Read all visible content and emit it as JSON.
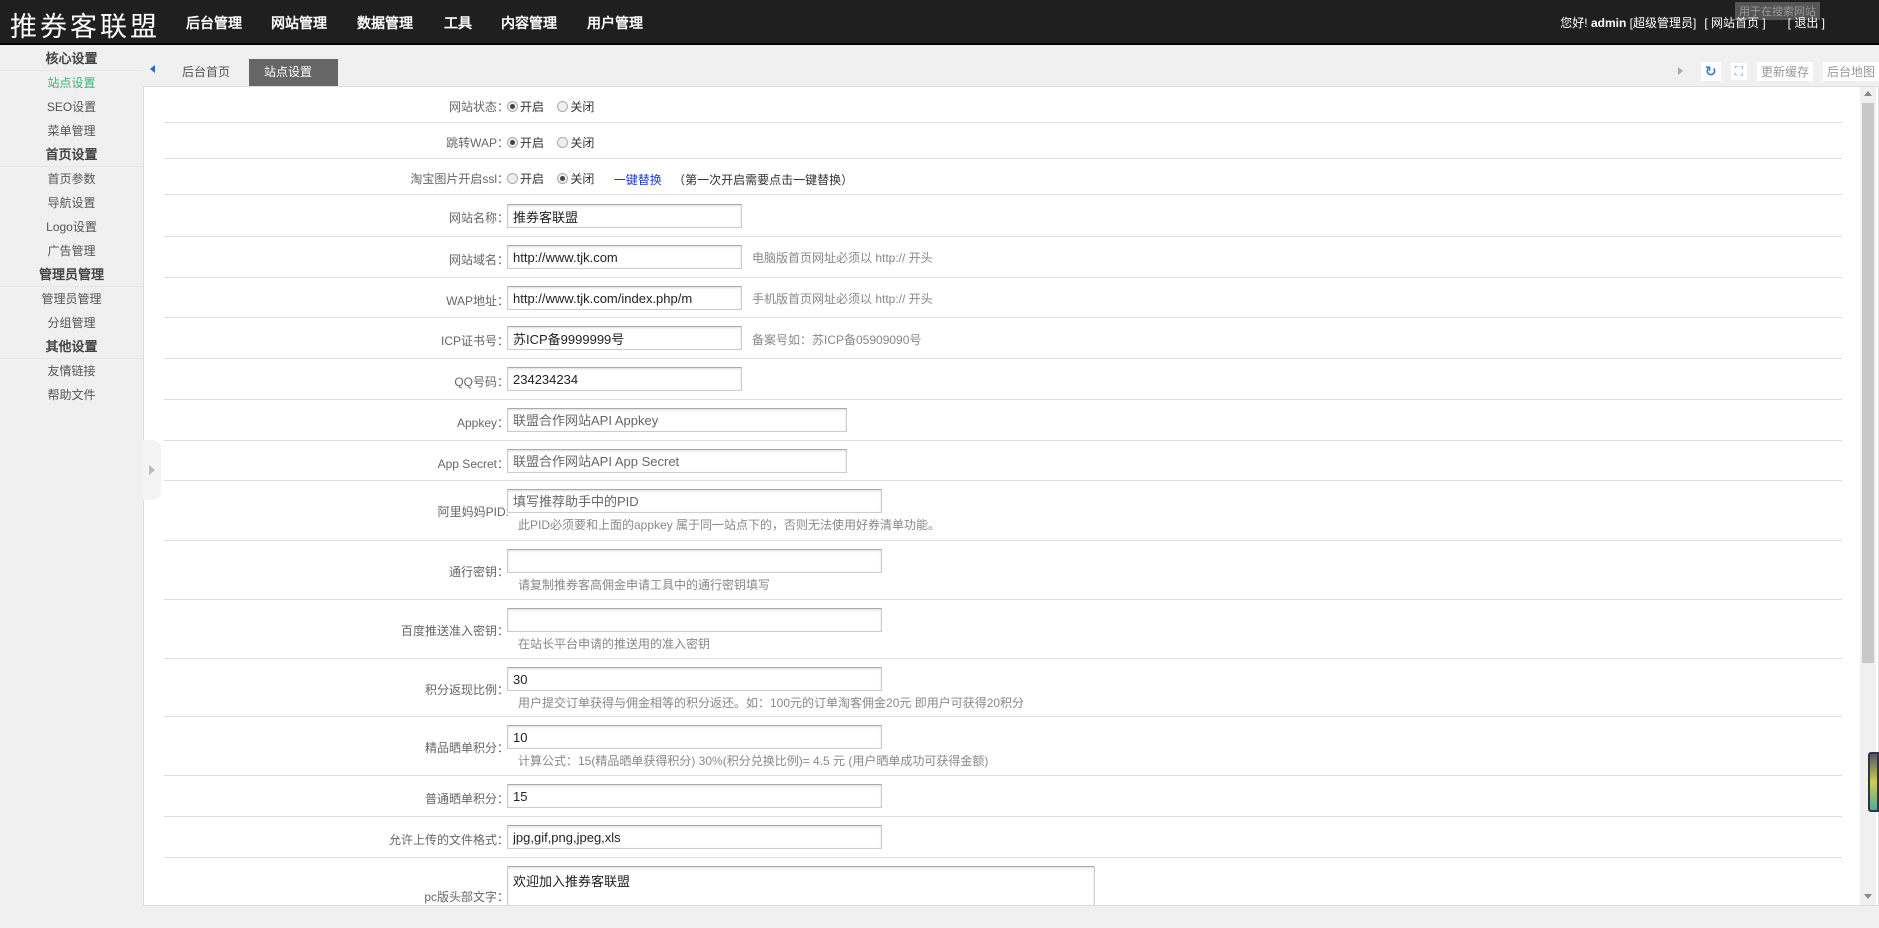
{
  "header": {
    "logo": "推券客联盟",
    "nav": [
      "后台管理",
      "网站管理",
      "数据管理",
      "工具",
      "内容管理",
      "用户管理"
    ],
    "greeting": "您好!",
    "user": "admin",
    "role": "[超级管理员]",
    "home_link": "[ 网站首页 ]",
    "logout": "[ 退出 ]",
    "tooltip": "用于在搜索网站"
  },
  "sidebar": [
    {
      "group": "核心设置",
      "items": [
        "站点设置",
        "SEO设置",
        "菜单管理"
      ]
    },
    {
      "group": "首页设置",
      "items": [
        "首页参数",
        "导航设置",
        "Logo设置",
        "广告管理"
      ]
    },
    {
      "group": "管理员管理",
      "items": [
        "管理员管理",
        "分组管理"
      ]
    },
    {
      "group": "其他设置",
      "items": [
        "友情链接",
        "帮助文件"
      ]
    }
  ],
  "tabs": {
    "home": "后台首页",
    "active": "站点设置",
    "close": "×",
    "refresh_cache": "更新缓存",
    "sitemap": "后台地图"
  },
  "form": {
    "site_status": {
      "label": "网站状态：",
      "on": "开启",
      "off": "关闭",
      "value": "on"
    },
    "wap_redirect": {
      "label": "跳转WAP：",
      "on": "开启",
      "off": "关闭",
      "value": "on"
    },
    "taobao_ssl": {
      "label": "淘宝图片开启ssl：",
      "on": "开启",
      "off": "关闭",
      "value": "off",
      "link": "一键替换",
      "note": "（第一次开启需要点击一键替换）"
    },
    "site_name": {
      "label": "网站名称：",
      "value": "推券客联盟"
    },
    "domain": {
      "label": "网站域名：",
      "value": "http://www.tjk.com",
      "hint": "电脑版首页网址必须以 http:// 开头"
    },
    "wap_url": {
      "label": "WAP地址：",
      "value": "http://www.tjk.com/index.php/m",
      "hint": "手机版首页网址必须以 http:// 开头"
    },
    "icp": {
      "label": "ICP证书号：",
      "value": "苏ICP备9999999号",
      "hint": "备案号如：苏ICP备05909090号"
    },
    "qq": {
      "label": "QQ号码：",
      "value": "234234234"
    },
    "appkey": {
      "label": "Appkey：",
      "placeholder": "联盟合作网站API Appkey"
    },
    "app_secret": {
      "label": "App Secret：",
      "placeholder": "联盟合作网站API App Secret"
    },
    "pid": {
      "label": "阿里妈妈PID:",
      "placeholder": "填写推荐助手中的PID",
      "hint": "此PID必须要和上面的appkey 属于同一站点下的，否则无法使用好券清单功能。"
    },
    "pass_key": {
      "label": "通行密钥：",
      "value": "",
      "hint": "请复制推券客高佣金申请工具中的通行密钥填写"
    },
    "baidu_key": {
      "label": "百度推送准入密钥：",
      "value": "",
      "hint": "在站长平台申请的推送用的准入密钥"
    },
    "points_ratio": {
      "label": "积分返现比例：",
      "value": "30",
      "hint": "用户提交订单获得与佣金相等的积分返还。如：100元的订单淘客佣金20元 即用户可获得20积分"
    },
    "premium_points": {
      "label": "精品晒单积分：",
      "value": "10",
      "hint": "计算公式：15(精品晒单获得积分) 30%(积分兑换比例)= 4.5 元 (用户晒单成功可获得金额)"
    },
    "normal_points": {
      "label": "普通晒单积分：",
      "value": "15"
    },
    "file_types": {
      "label": "允许上传的文件格式：",
      "value": "jpg,gif,png,jpeg,xls"
    },
    "pc_header": {
      "label": "pc版头部文字：",
      "value": "欢迎加入推券客联盟"
    }
  }
}
